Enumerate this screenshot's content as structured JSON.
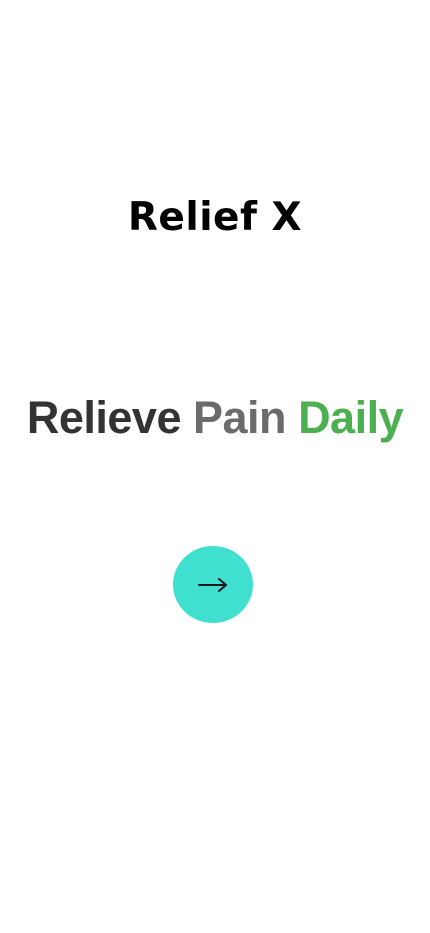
{
  "app": {
    "logo_text": "Relief X"
  },
  "tagline": {
    "word1": "Relieve",
    "word2": "Pain",
    "word3": "Daily"
  },
  "colors": {
    "word1": "#333333",
    "word2": "#6b6b6b",
    "word3": "#4caf50",
    "accent": "#3fe0d0"
  },
  "next_button": {
    "icon": "arrow-right-icon"
  }
}
